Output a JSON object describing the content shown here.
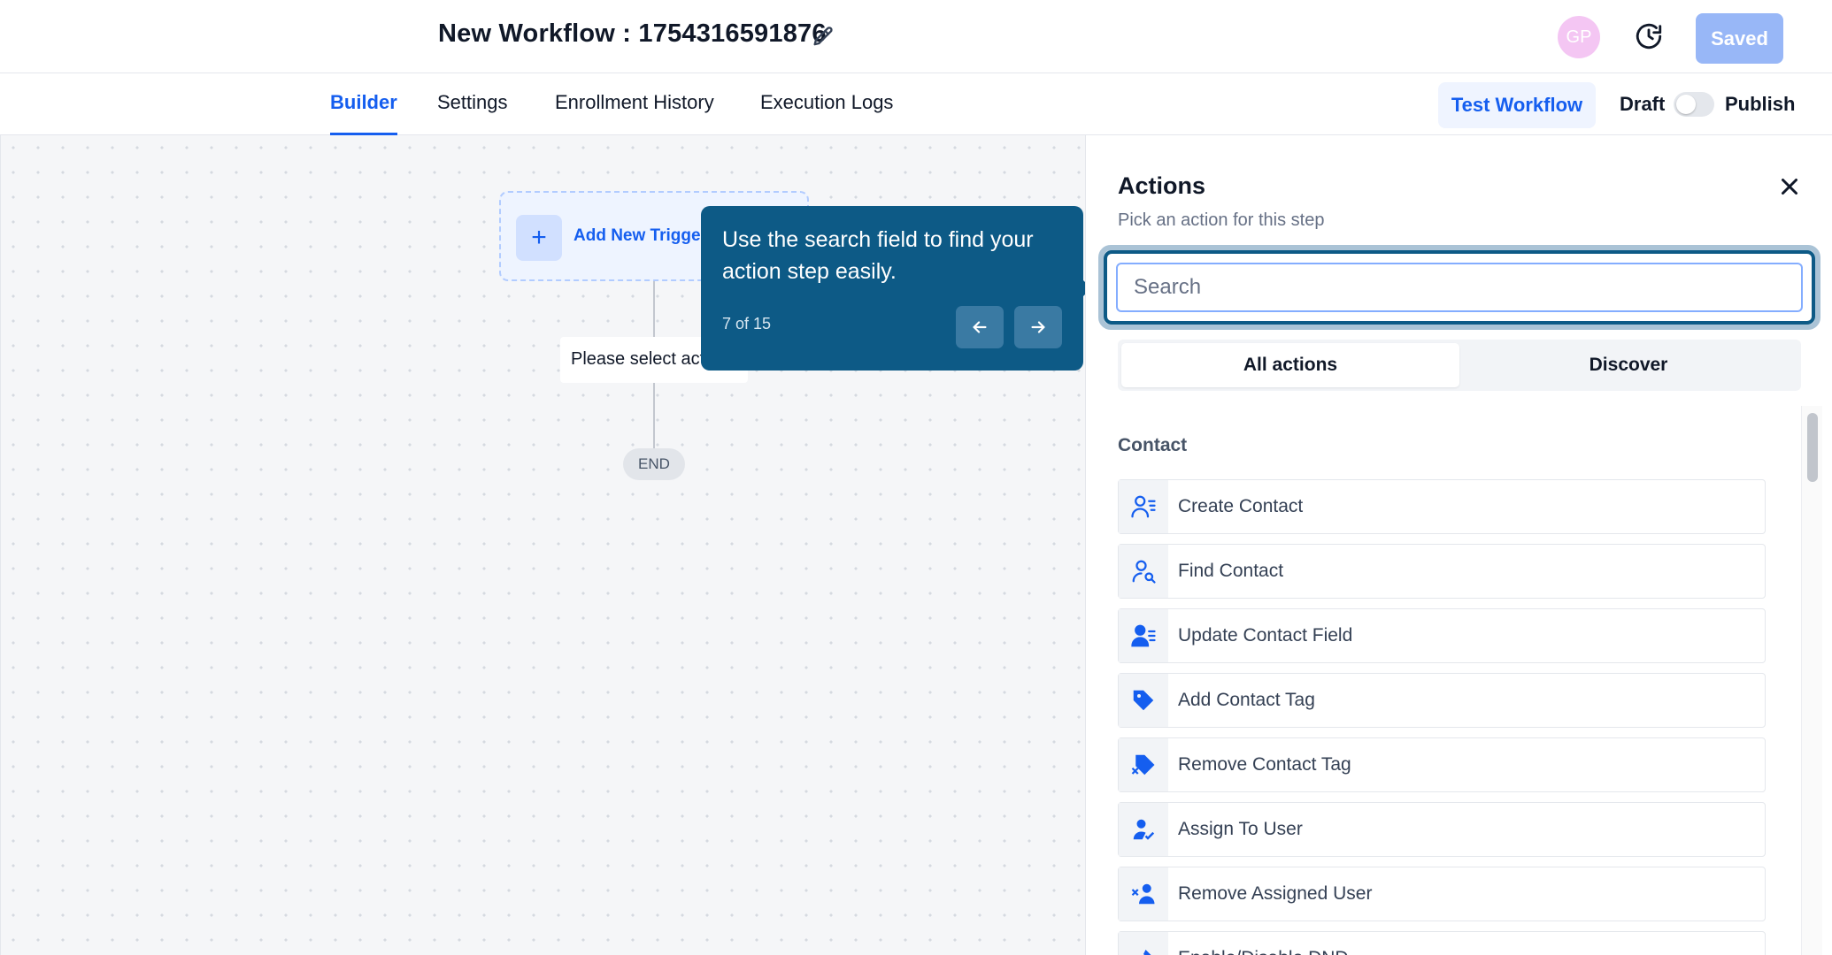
{
  "header": {
    "title": "New Workflow : 1754316591876",
    "avatar_initials": "GP",
    "saved_label": "Saved"
  },
  "tabs": [
    {
      "label": "Builder",
      "active": true
    },
    {
      "label": "Settings",
      "active": false
    },
    {
      "label": "Enrollment History",
      "active": false
    },
    {
      "label": "Execution Logs",
      "active": false
    }
  ],
  "toolbar": {
    "test_label": "Test Workflow",
    "draft_label": "Draft",
    "publish_label": "Publish",
    "publish_toggle_on": false
  },
  "canvas": {
    "trigger_label": "Add New Trigger",
    "action_placeholder": "Please select action",
    "end_label": "END"
  },
  "tooltip": {
    "text": "Use the search field to find your action step easily.",
    "step": "7 of 15"
  },
  "panel": {
    "title": "Actions",
    "subtitle": "Pick an action for this step",
    "search_placeholder": "Search",
    "segments": [
      "All actions",
      "Discover"
    ],
    "category": "Contact",
    "actions": [
      {
        "label": "Create Contact",
        "icon": "user-lines-icon"
      },
      {
        "label": "Find Contact",
        "icon": "user-search-icon"
      },
      {
        "label": "Update Contact Field",
        "icon": "user-edit-icon"
      },
      {
        "label": "Add Contact Tag",
        "icon": "tag-icon"
      },
      {
        "label": "Remove Contact Tag",
        "icon": "tag-remove-icon"
      },
      {
        "label": "Assign To User",
        "icon": "user-check-icon"
      },
      {
        "label": "Remove Assigned User",
        "icon": "user-remove-icon"
      },
      {
        "label": "Enable/Disable DND",
        "icon": "dnd-icon"
      }
    ]
  },
  "colors": {
    "primary": "#155eef",
    "tooltip_bg": "#0d5a86",
    "saved_bg": "#98b7f7"
  }
}
